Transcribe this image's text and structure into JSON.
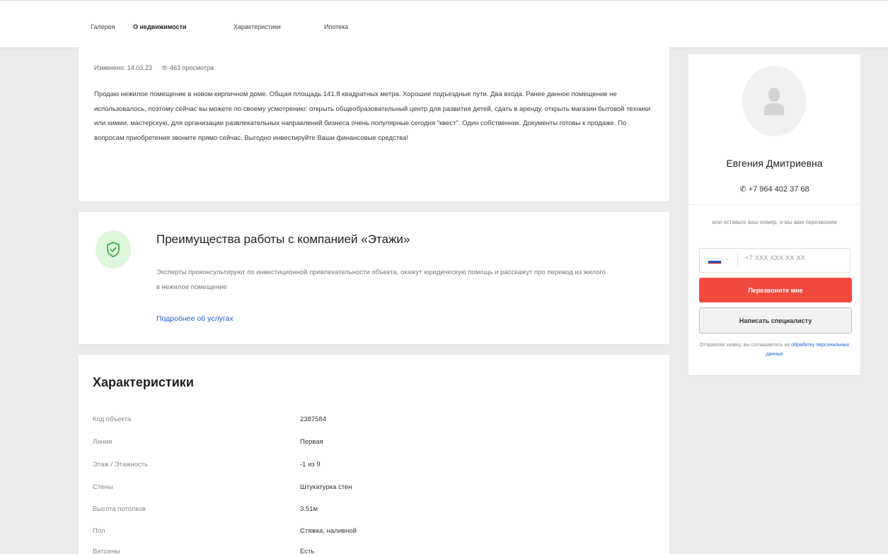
{
  "nav": {
    "tabs": [
      {
        "label": "Галерея"
      },
      {
        "label": "О недвижимости"
      },
      {
        "label": "Характеристики"
      },
      {
        "label": "Ипотека"
      }
    ]
  },
  "description": {
    "meta": "Изменено: 14.03.23",
    "views": "463 просмотра",
    "text": "Продаю нежилое помещение в новом кирпичном доме. Общая площадь 141.8 квадратных метра. Хорошие подъездные пути. Два входа. Ранее данное помещение не использовалось, поэтому сейчас вы можете по своему усмотрению: открыть общеобразовательный центр для развития детей, сдать в аренду, открыть магазин бытовой техники или химии, мастерскую, для организации развлекательных направлений бизнеса очень популярные сегодня \"квест\". Один собственник. Документы готовы к продаже. По вопросам приобретения звоните прямо сейчас. Выгодно инвестируйте Ваши финансовые средства!"
  },
  "advantages": {
    "title": "Преимущества работы с компанией «Этажи»",
    "text": "Эксперты проконсультируют по инвестиционной привлекательности объекта, окажут юридическую помощь и расскажут про перевод из жилого в нежилое помещение",
    "link": "Подробнее об услугах",
    "colors": {
      "shield_bg": "#dff5dc",
      "shield_stroke": "#3fae4a"
    }
  },
  "characteristics": {
    "title": "Характеристики",
    "rows": [
      {
        "key": "Код объекта",
        "value": "2387584"
      },
      {
        "key": "Линия",
        "value": "Первая"
      },
      {
        "key": "Этаж / Этажность",
        "value": "-1 из 9"
      },
      {
        "key": "Стены",
        "value": "Штукатурка стен"
      },
      {
        "key": "Высота потолков",
        "value": "3.51м"
      },
      {
        "key": "Пол",
        "value": "Стяжка, наливной"
      },
      {
        "key": "Витрины",
        "value": "Есть"
      }
    ]
  },
  "agent": {
    "name": "Евгения Дмитриевна",
    "phone": "+7 964 402 37 68",
    "callback_text": "или оставьте ваш номер, и мы вам перезвоним",
    "phone_placeholder": "+7 XXX XXX XX XX",
    "callback_button": "Перезвоните мне",
    "write_button": "Написать специалисту",
    "consent_prefix": "Отправляя заявку, вы соглашаетесь на",
    "consent_link": "обработку персональных данных",
    "colors": {
      "primary_button": "#ef4a3d",
      "link": "#1c5fd6"
    }
  }
}
